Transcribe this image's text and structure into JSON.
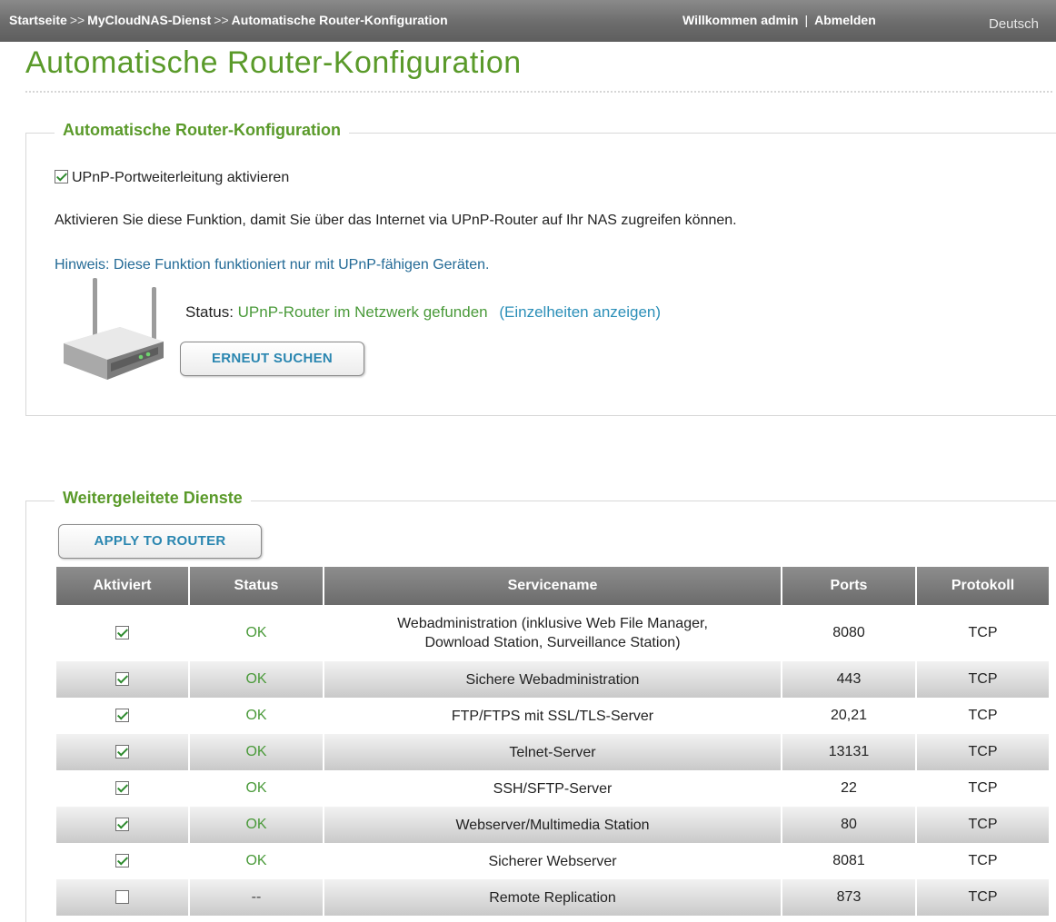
{
  "topbar": {
    "breadcrumb": [
      "Startseite",
      "MyCloudNAS-Dienst",
      "Automatische Router-Konfiguration"
    ],
    "breadcrumb_separator": ">>",
    "welcome_text": "Willkommen admin",
    "logout_label": "Abmelden",
    "language": "Deutsch"
  },
  "page": {
    "title": "Automatische Router-Konfiguration"
  },
  "router_section": {
    "legend": "Automatische Router-Konfiguration",
    "upnp_checkbox_label": "UPnP-Portweiterleitung aktivieren",
    "upnp_checked": true,
    "description": "Aktivieren Sie diese Funktion, damit Sie über das Internet via UPnP-Router auf Ihr NAS zugreifen können.",
    "hint": "Hinweis: Diese Funktion funktioniert nur mit UPnP-fähigen Geräten.",
    "status_label": "Status:",
    "status_value": "UPnP-Router im Netzwerk gefunden",
    "details_link": "(Einzelheiten anzeigen)",
    "search_button": "ERNEUT SUCHEN",
    "router_icon": "router-icon"
  },
  "services_section": {
    "legend": "Weitergeleitete Dienste",
    "apply_button": "APPLY TO ROUTER",
    "columns": [
      "Aktiviert",
      "Status",
      "Servicename",
      "Ports",
      "Protokoll"
    ],
    "rows": [
      {
        "enabled": true,
        "status": "OK",
        "name_lines": [
          "Webadministration (inklusive Web File Manager,",
          "Download Station, Surveillance Station)"
        ],
        "ports": "8080",
        "protocol": "TCP"
      },
      {
        "enabled": true,
        "status": "OK",
        "name_lines": [
          "Sichere Webadministration"
        ],
        "ports": "443",
        "protocol": "TCP"
      },
      {
        "enabled": true,
        "status": "OK",
        "name_lines": [
          "FTP/FTPS mit SSL/TLS-Server"
        ],
        "ports": "20,21",
        "protocol": "TCP"
      },
      {
        "enabled": true,
        "status": "OK",
        "name_lines": [
          "Telnet-Server"
        ],
        "ports": "13131",
        "protocol": "TCP"
      },
      {
        "enabled": true,
        "status": "OK",
        "name_lines": [
          "SSH/SFTP-Server"
        ],
        "ports": "22",
        "protocol": "TCP"
      },
      {
        "enabled": true,
        "status": "OK",
        "name_lines": [
          "Webserver/Multimedia Station"
        ],
        "ports": "80",
        "protocol": "TCP"
      },
      {
        "enabled": true,
        "status": "OK",
        "name_lines": [
          "Sicherer Webserver"
        ],
        "ports": "8081",
        "protocol": "TCP"
      },
      {
        "enabled": false,
        "status": "--",
        "name_lines": [
          "Remote Replication"
        ],
        "ports": "873",
        "protocol": "TCP"
      }
    ]
  },
  "colors": {
    "accent_green": "#5a9a2a",
    "status_ok_green": "#4a9a3a",
    "link_blue": "#2b8fb8",
    "hint_blue": "#236a96",
    "header_gray": "#6b6b6b"
  }
}
